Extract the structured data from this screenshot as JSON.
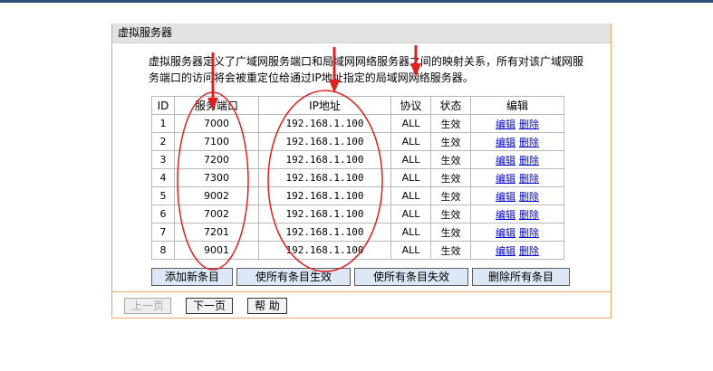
{
  "panel": {
    "title": "虚拟服务器",
    "description": "虚拟服务器定义了广域网服务端口和局域网网络服务器之间的映射关系，所有对该广域网服务端口的访问将会被重定位给通过IP地址指定的局域网网络服务器。"
  },
  "table": {
    "headers": [
      "ID",
      "服务端口",
      "IP地址",
      "协议",
      "状态",
      "编辑"
    ],
    "edit_label": "编辑",
    "delete_label": "删除",
    "rows": [
      {
        "id": "1",
        "port": "7000",
        "ip": "192.168.1.100",
        "protocol": "ALL",
        "status": "生效"
      },
      {
        "id": "2",
        "port": "7100",
        "ip": "192.168.1.100",
        "protocol": "ALL",
        "status": "生效"
      },
      {
        "id": "3",
        "port": "7200",
        "ip": "192.168.1.100",
        "protocol": "ALL",
        "status": "生效"
      },
      {
        "id": "4",
        "port": "7300",
        "ip": "192.168.1.100",
        "protocol": "ALL",
        "status": "生效"
      },
      {
        "id": "5",
        "port": "9002",
        "ip": "192.168.1.100",
        "protocol": "ALL",
        "status": "生效"
      },
      {
        "id": "6",
        "port": "7002",
        "ip": "192.168.1.100",
        "protocol": "ALL",
        "status": "生效"
      },
      {
        "id": "7",
        "port": "7201",
        "ip": "192.168.1.100",
        "protocol": "ALL",
        "status": "生效"
      },
      {
        "id": "8",
        "port": "9001",
        "ip": "192.168.1.100",
        "protocol": "ALL",
        "status": "生效"
      }
    ]
  },
  "actions": {
    "add": "添加新条目",
    "enable_all": "使所有条目生效",
    "disable_all": "使所有条目失效",
    "delete_all": "删除所有条目"
  },
  "footer": {
    "prev": "上一页",
    "next": "下一页",
    "help": "帮 助"
  },
  "colors": {
    "annotation": "#e02020",
    "panel_border": "#e7a55e",
    "button_bg": "#dce8f6",
    "link": "#0000cc"
  },
  "annotations": {
    "arrows": [
      "arrow-icon",
      "arrow-icon",
      "arrow-icon"
    ],
    "circles": [
      "port-column-circle",
      "ip-column-circle"
    ]
  }
}
